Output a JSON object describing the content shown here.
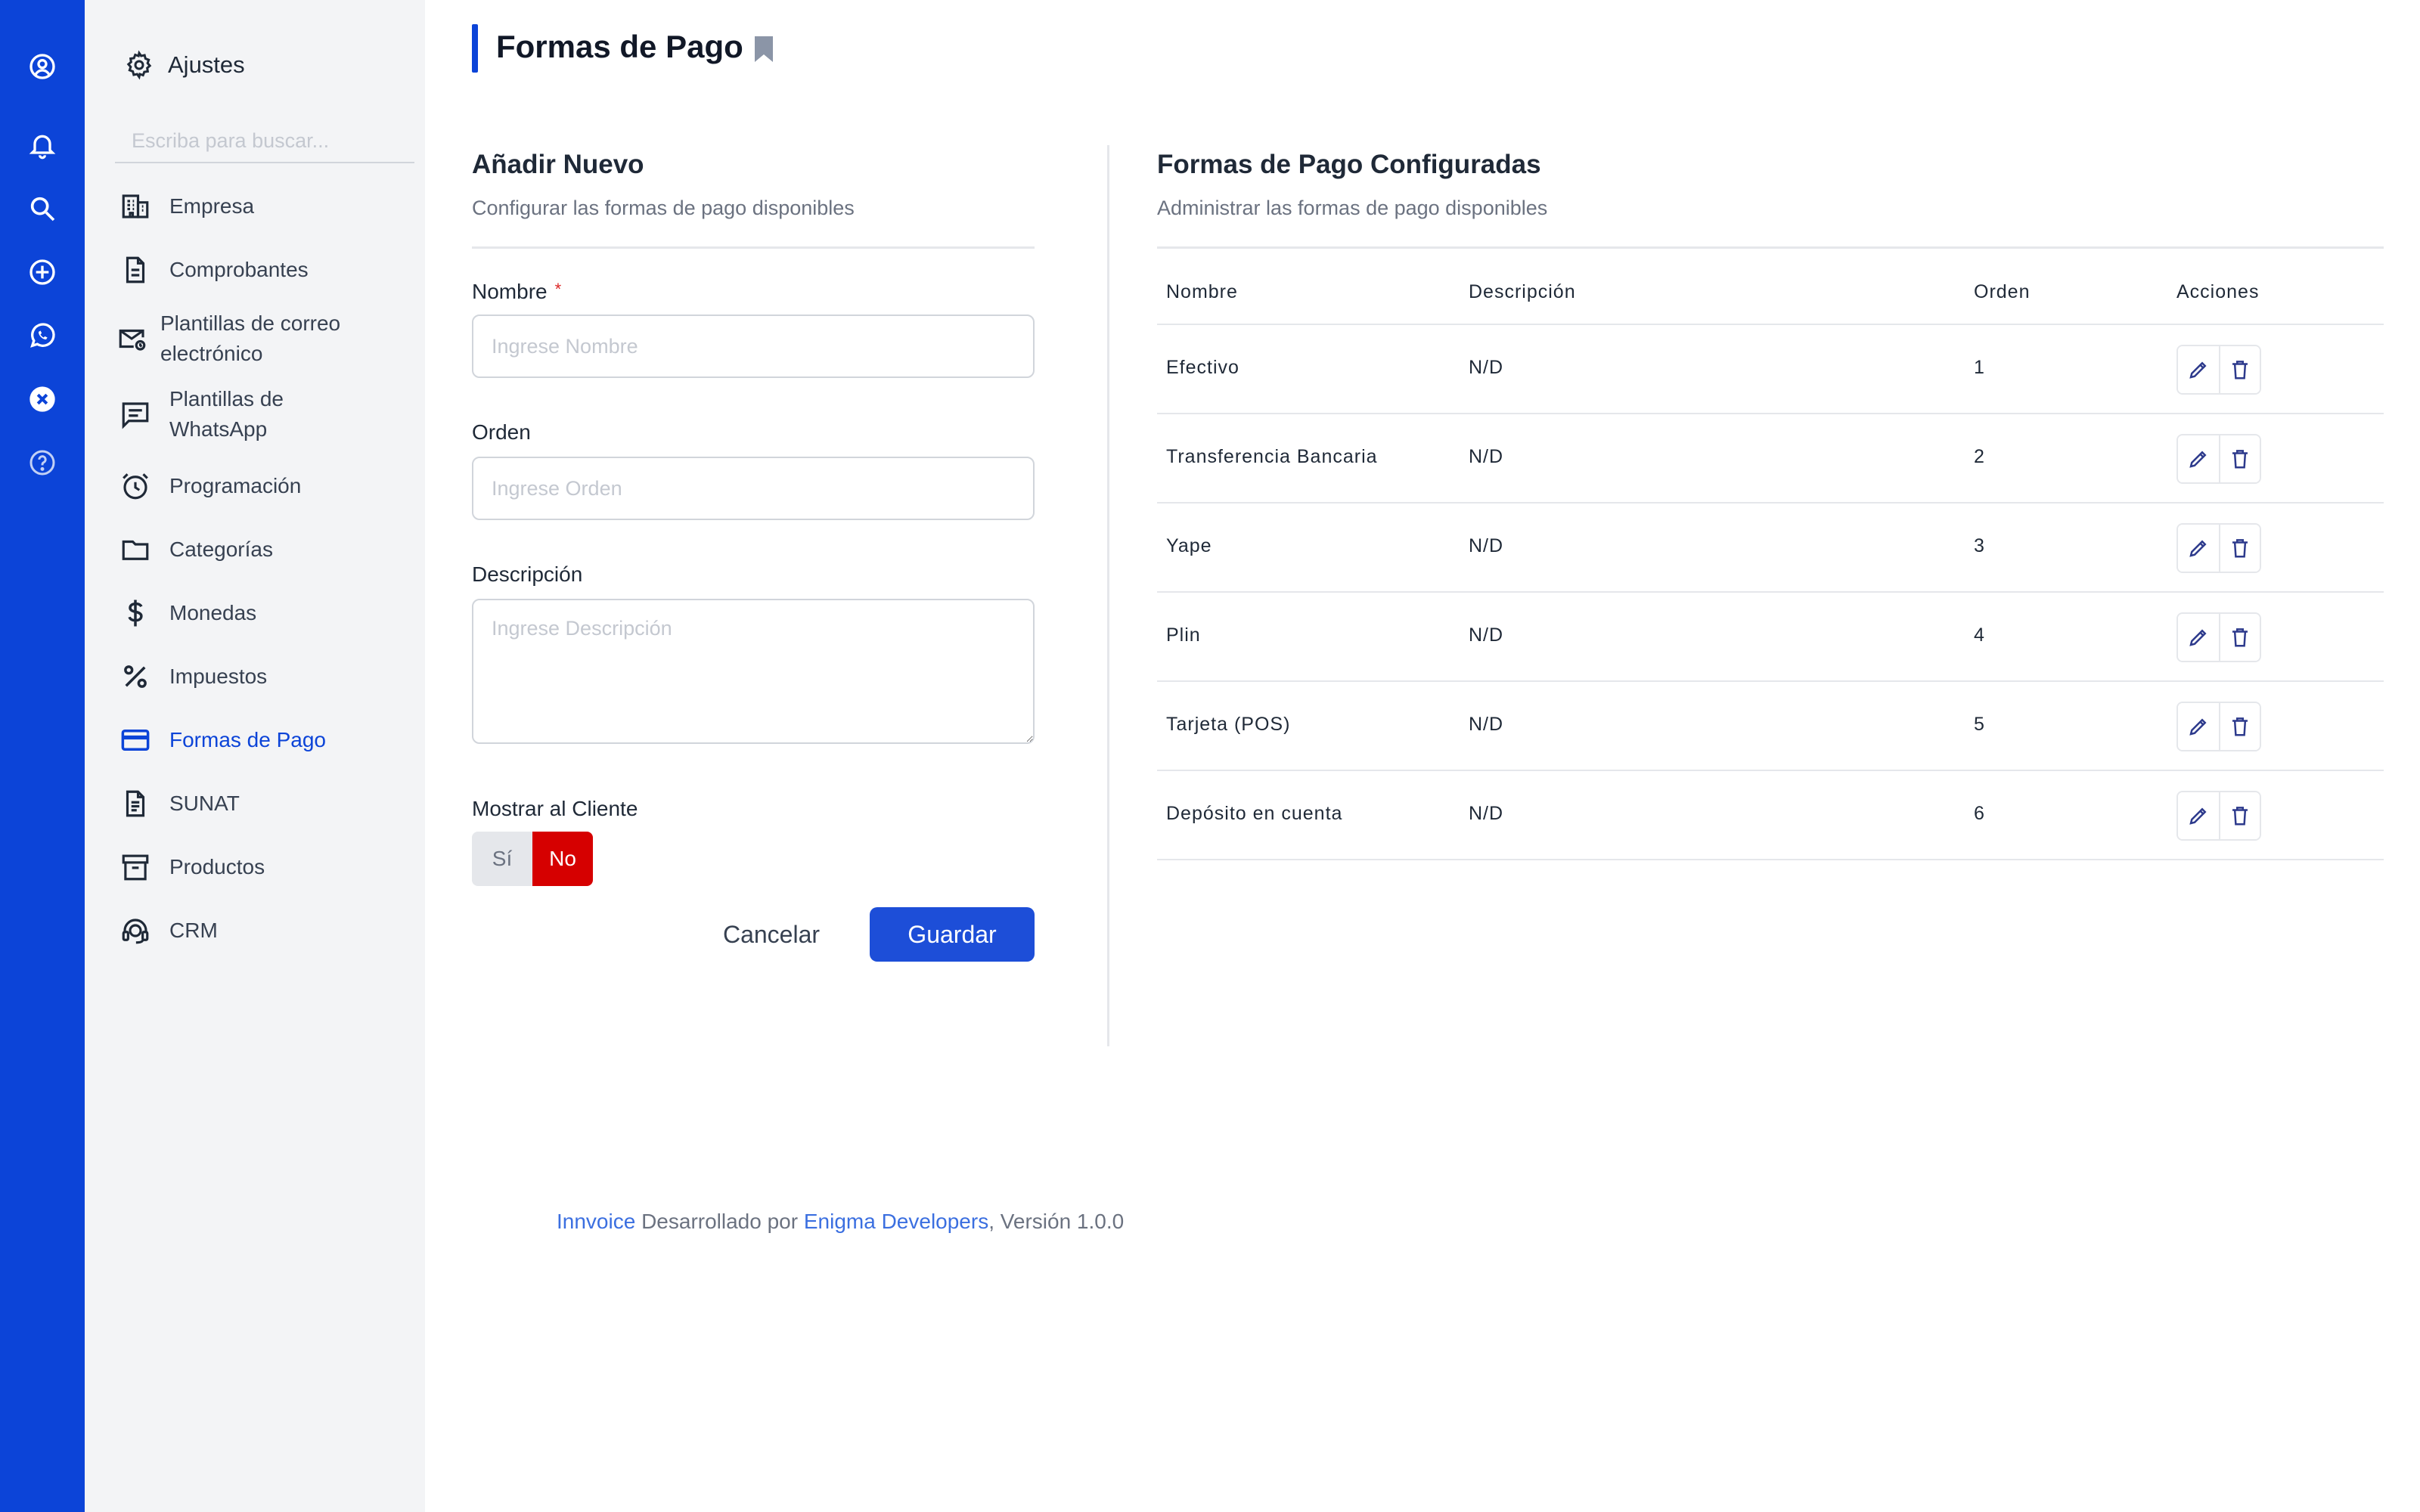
{
  "rail": {
    "icons": [
      "user-circle-icon",
      "bell-icon",
      "search-icon",
      "plus-circle-icon",
      "whatsapp-icon",
      "close-circle-icon",
      "help-icon"
    ]
  },
  "sidebar": {
    "title": "Ajustes",
    "search_placeholder": "Escriba para buscar...",
    "items": [
      {
        "label": "Empresa",
        "icon": "building-icon"
      },
      {
        "label": "Comprobantes",
        "icon": "document-icon"
      },
      {
        "label": "Plantillas de correo electrónico",
        "icon": "mail-template-icon"
      },
      {
        "label": "Plantillas de WhatsApp",
        "icon": "message-template-icon"
      },
      {
        "label": "Programación",
        "icon": "alarm-clock-icon"
      },
      {
        "label": "Categorías",
        "icon": "folder-icon"
      },
      {
        "label": "Monedas",
        "icon": "dollar-icon"
      },
      {
        "label": "Impuestos",
        "icon": "percent-icon"
      },
      {
        "label": "Formas de Pago",
        "icon": "credit-card-icon",
        "active": true
      },
      {
        "label": "SUNAT",
        "icon": "file-text-icon"
      },
      {
        "label": "Productos",
        "icon": "archive-box-icon"
      },
      {
        "label": "CRM",
        "icon": "support-agent-icon"
      }
    ]
  },
  "page": {
    "title": "Formas de Pago"
  },
  "form": {
    "title": "Añadir Nuevo",
    "subtitle": "Configurar las formas de pago disponibles",
    "name_label": "Nombre",
    "required_mark": "*",
    "name_placeholder": "Ingrese Nombre",
    "order_label": "Orden",
    "order_placeholder": "Ingrese Orden",
    "description_label": "Descripción",
    "description_placeholder": "Ingrese Descripción",
    "show_client_label": "Mostrar al Cliente",
    "toggle_yes": "Sí",
    "toggle_no": "No",
    "cancel_label": "Cancelar",
    "save_label": "Guardar"
  },
  "list": {
    "title": "Formas de Pago Configuradas",
    "subtitle": "Administrar las formas de pago disponibles",
    "columns": [
      "Nombre",
      "Descripción",
      "Orden",
      "Acciones"
    ],
    "rows": [
      {
        "name": "Efectivo",
        "description": "N/D",
        "order": "1"
      },
      {
        "name": "Transferencia Bancaria",
        "description": "N/D",
        "order": "2"
      },
      {
        "name": "Yape",
        "description": "N/D",
        "order": "3"
      },
      {
        "name": "Plin",
        "description": "N/D",
        "order": "4"
      },
      {
        "name": "Tarjeta (POS)",
        "description": "N/D",
        "order": "5"
      },
      {
        "name": "Depósito en cuenta",
        "description": "N/D",
        "order": "6"
      }
    ]
  },
  "footer": {
    "brand": "Innvoice",
    "middle": " Desarrollado por ",
    "developer": "Enigma Developers",
    "version": ", Versión 1.0.0"
  },
  "colors": {
    "primary": "#0c44d8",
    "danger": "#d60000",
    "link": "#3b6fe0"
  }
}
